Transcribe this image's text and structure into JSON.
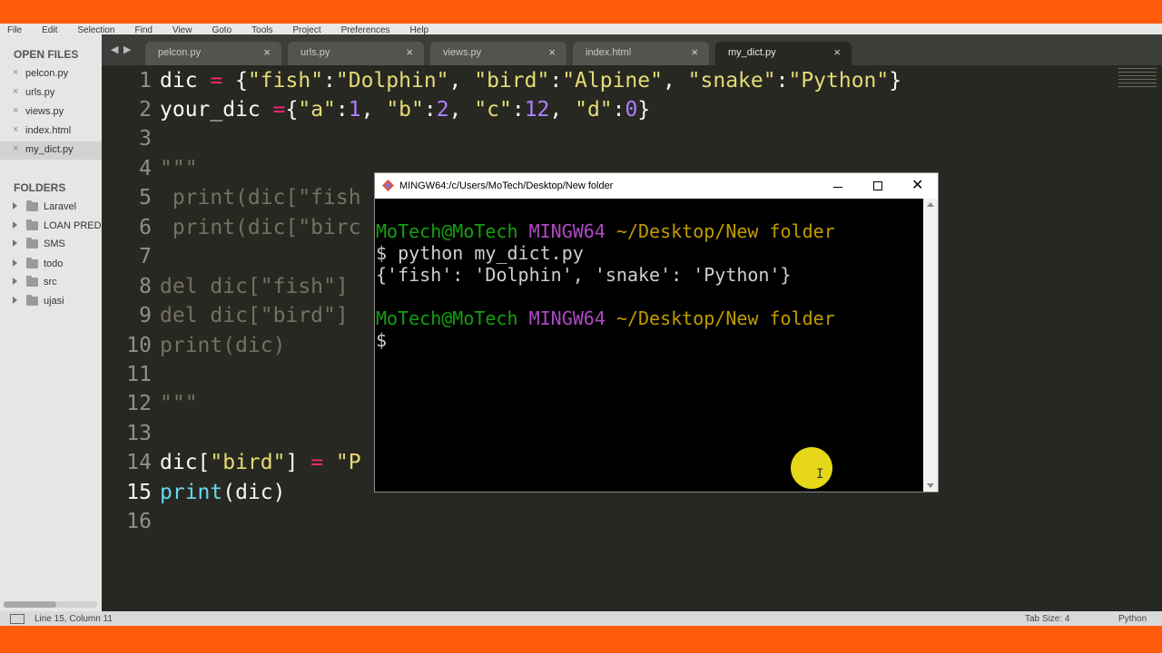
{
  "menu": [
    "File",
    "Edit",
    "Selection",
    "Find",
    "View",
    "Goto",
    "Tools",
    "Project",
    "Preferences",
    "Help"
  ],
  "sidebar": {
    "open_files_heading": "OPEN FILES",
    "open_files": [
      "pelcon.py",
      "urls.py",
      "views.py",
      "index.html",
      "my_dict.py"
    ],
    "folders_heading": "FOLDERS",
    "folders": [
      "Laravel",
      "LOAN PREDI",
      "SMS",
      "todo",
      "src",
      "ujasi"
    ]
  },
  "tabs": {
    "nav_left": "◀",
    "nav_right": "▶",
    "items": [
      "pelcon.py",
      "urls.py",
      "views.py",
      "index.html",
      "my_dict.py"
    ],
    "close_glyph": "×"
  },
  "editor": {
    "line_numbers": [
      "1",
      "2",
      "3",
      "4",
      "5",
      "6",
      "7",
      "8",
      "9",
      "10",
      "11",
      "12",
      "13",
      "14",
      "15",
      "16"
    ],
    "current_line": "15",
    "lines": {
      "l1": [
        {
          "t": "dic "
        },
        {
          "t": "=",
          "c": "op"
        },
        {
          "t": " {"
        },
        {
          "t": "\"fish\"",
          "c": "st"
        },
        {
          "t": ":"
        },
        {
          "t": "\"Dolphin\"",
          "c": "st"
        },
        {
          "t": ", "
        },
        {
          "t": "\"bird\"",
          "c": "st"
        },
        {
          "t": ":"
        },
        {
          "t": "\"Alpine\"",
          "c": "st"
        },
        {
          "t": ", "
        },
        {
          "t": "\"snake\"",
          "c": "st"
        },
        {
          "t": ":"
        },
        {
          "t": "\"Python\"",
          "c": "st"
        },
        {
          "t": "}"
        }
      ],
      "l2": [
        {
          "t": "your_dic "
        },
        {
          "t": "=",
          "c": "op"
        },
        {
          "t": "{"
        },
        {
          "t": "\"a\"",
          "c": "st"
        },
        {
          "t": ":"
        },
        {
          "t": "1",
          "c": "nu"
        },
        {
          "t": ", "
        },
        {
          "t": "\"b\"",
          "c": "st"
        },
        {
          "t": ":"
        },
        {
          "t": "2",
          "c": "nu"
        },
        {
          "t": ", "
        },
        {
          "t": "\"c\"",
          "c": "st"
        },
        {
          "t": ":"
        },
        {
          "t": "12",
          "c": "nu"
        },
        {
          "t": ", "
        },
        {
          "t": "\"d\"",
          "c": "st"
        },
        {
          "t": ":"
        },
        {
          "t": "0",
          "c": "nu"
        },
        {
          "t": "}"
        }
      ],
      "l4": [
        {
          "t": "\"\"\"",
          "c": "cm"
        }
      ],
      "l5": [
        {
          "t": " print(dic[\"fish",
          "c": "cm"
        }
      ],
      "l6": [
        {
          "t": " print(dic[\"birc",
          "c": "cm"
        }
      ],
      "l8": [
        {
          "t": "del dic[\"fish\"]",
          "c": "cm"
        }
      ],
      "l9": [
        {
          "t": "del dic[\"bird\"]",
          "c": "cm"
        }
      ],
      "l10": [
        {
          "t": "print(dic)",
          "c": "cm"
        }
      ],
      "l12": [
        {
          "t": "\"\"\"",
          "c": "cm"
        }
      ],
      "l14": [
        {
          "t": "dic["
        },
        {
          "t": "\"bird\"",
          "c": "st"
        },
        {
          "t": "] "
        },
        {
          "t": "=",
          "c": "op"
        },
        {
          "t": " "
        },
        {
          "t": "\"P",
          "c": "st"
        }
      ],
      "l15": [
        {
          "t": "print",
          "c": "fn"
        },
        {
          "t": "(dic)"
        }
      ]
    }
  },
  "terminal": {
    "title": "MINGW64:/c/Users/MoTech/Desktop/New folder",
    "prompt_user": "MoTech@MoTech",
    "prompt_env": "MINGW64",
    "prompt_path": "~/Desktop/New folder",
    "command": "$ python my_dict.py",
    "output": "{'fish': 'Dolphin', 'snake': 'Python'}",
    "prompt_symbol": "$",
    "colors": {
      "user": "#13a10e",
      "env": "#b148c6",
      "path": "#c19c00"
    }
  },
  "status": {
    "position": "Line 15, Column 11",
    "tab_size": "Tab Size: 4",
    "syntax": "Python"
  },
  "theme": {
    "accent_frame": "#ff5a0a",
    "editor_bg": "#272822"
  }
}
